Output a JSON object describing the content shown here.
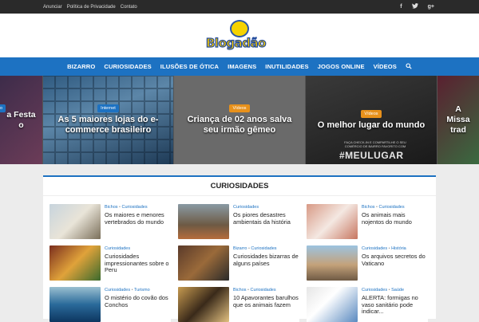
{
  "topbar": {
    "links": [
      "Anunciar",
      "Política de Privacidade",
      "Contato"
    ],
    "social": [
      {
        "icon": "facebook-icon",
        "glyph": "f"
      },
      {
        "icon": "twitter-icon",
        "glyph": "🐦"
      },
      {
        "icon": "googleplus-icon",
        "glyph": "g+"
      }
    ]
  },
  "logo": {
    "text": "Blogadão"
  },
  "nav": {
    "items": [
      "BIZARRO",
      "CURIOSIDADES",
      "ILUSÕES DE ÓTICA",
      "IMAGENS",
      "INUTILIDADES",
      "JOGOS ONLINE",
      "VÍDEOS"
    ],
    "search_icon": "search-icon"
  },
  "slider": {
    "slides": [
      {
        "badge": "o",
        "title": "a Festa o"
      },
      {
        "badge": "Internet",
        "title": "As 5 maiores lojas do e-commerce brasileiro"
      },
      {
        "badge": "Vídeos",
        "title": "Criança de 02 anos salva seu irmão gêmeo"
      },
      {
        "badge": "Vídeos",
        "title": "O melhor lugar do mundo",
        "overlay_small": "FAÇA CHECK-IN E COMPARTILHE O SEU COMÉRCIO DE BAIRRO FAVORITO COM",
        "overlay": "#MEULUGAR"
      },
      {
        "badge": "",
        "title": "A Missa trad"
      }
    ]
  },
  "section": {
    "title": "CURIOSIDADES"
  },
  "cards": [
    {
      "cat1": "Bichos",
      "cat2": "Curiosidades",
      "title": "Os maiores e menores vertebrados do mundo"
    },
    {
      "cat1": "Curiosidades",
      "cat2": "",
      "title": "Os piores desastres ambientais da história"
    },
    {
      "cat1": "Bichos",
      "cat2": "Curiosidades",
      "title": "Os animais mais nojentos do mundo"
    },
    {
      "cat1": "Curiosidades",
      "cat2": "",
      "title": "Curiosidades impressionantes sobre o Peru"
    },
    {
      "cat1": "Bizarro",
      "cat2": "Curiosidades",
      "title": "Curiosidades bizarras de alguns países"
    },
    {
      "cat1": "Curiosidades",
      "cat2": "História",
      "title": "Os arquivos secretos do Vaticano"
    },
    {
      "cat1": "Curiosidades",
      "cat2": "Turismo",
      "title": "O mistério do covão dos Conchos"
    },
    {
      "cat1": "Bichos",
      "cat2": "Curiosidades",
      "title": "10 Apavorantes barulhos que os animais fazem"
    },
    {
      "cat1": "Curiosidades",
      "cat2": "Saúde",
      "title": "ALERTA: formigas no vaso sanitário pode indicar..."
    }
  ]
}
